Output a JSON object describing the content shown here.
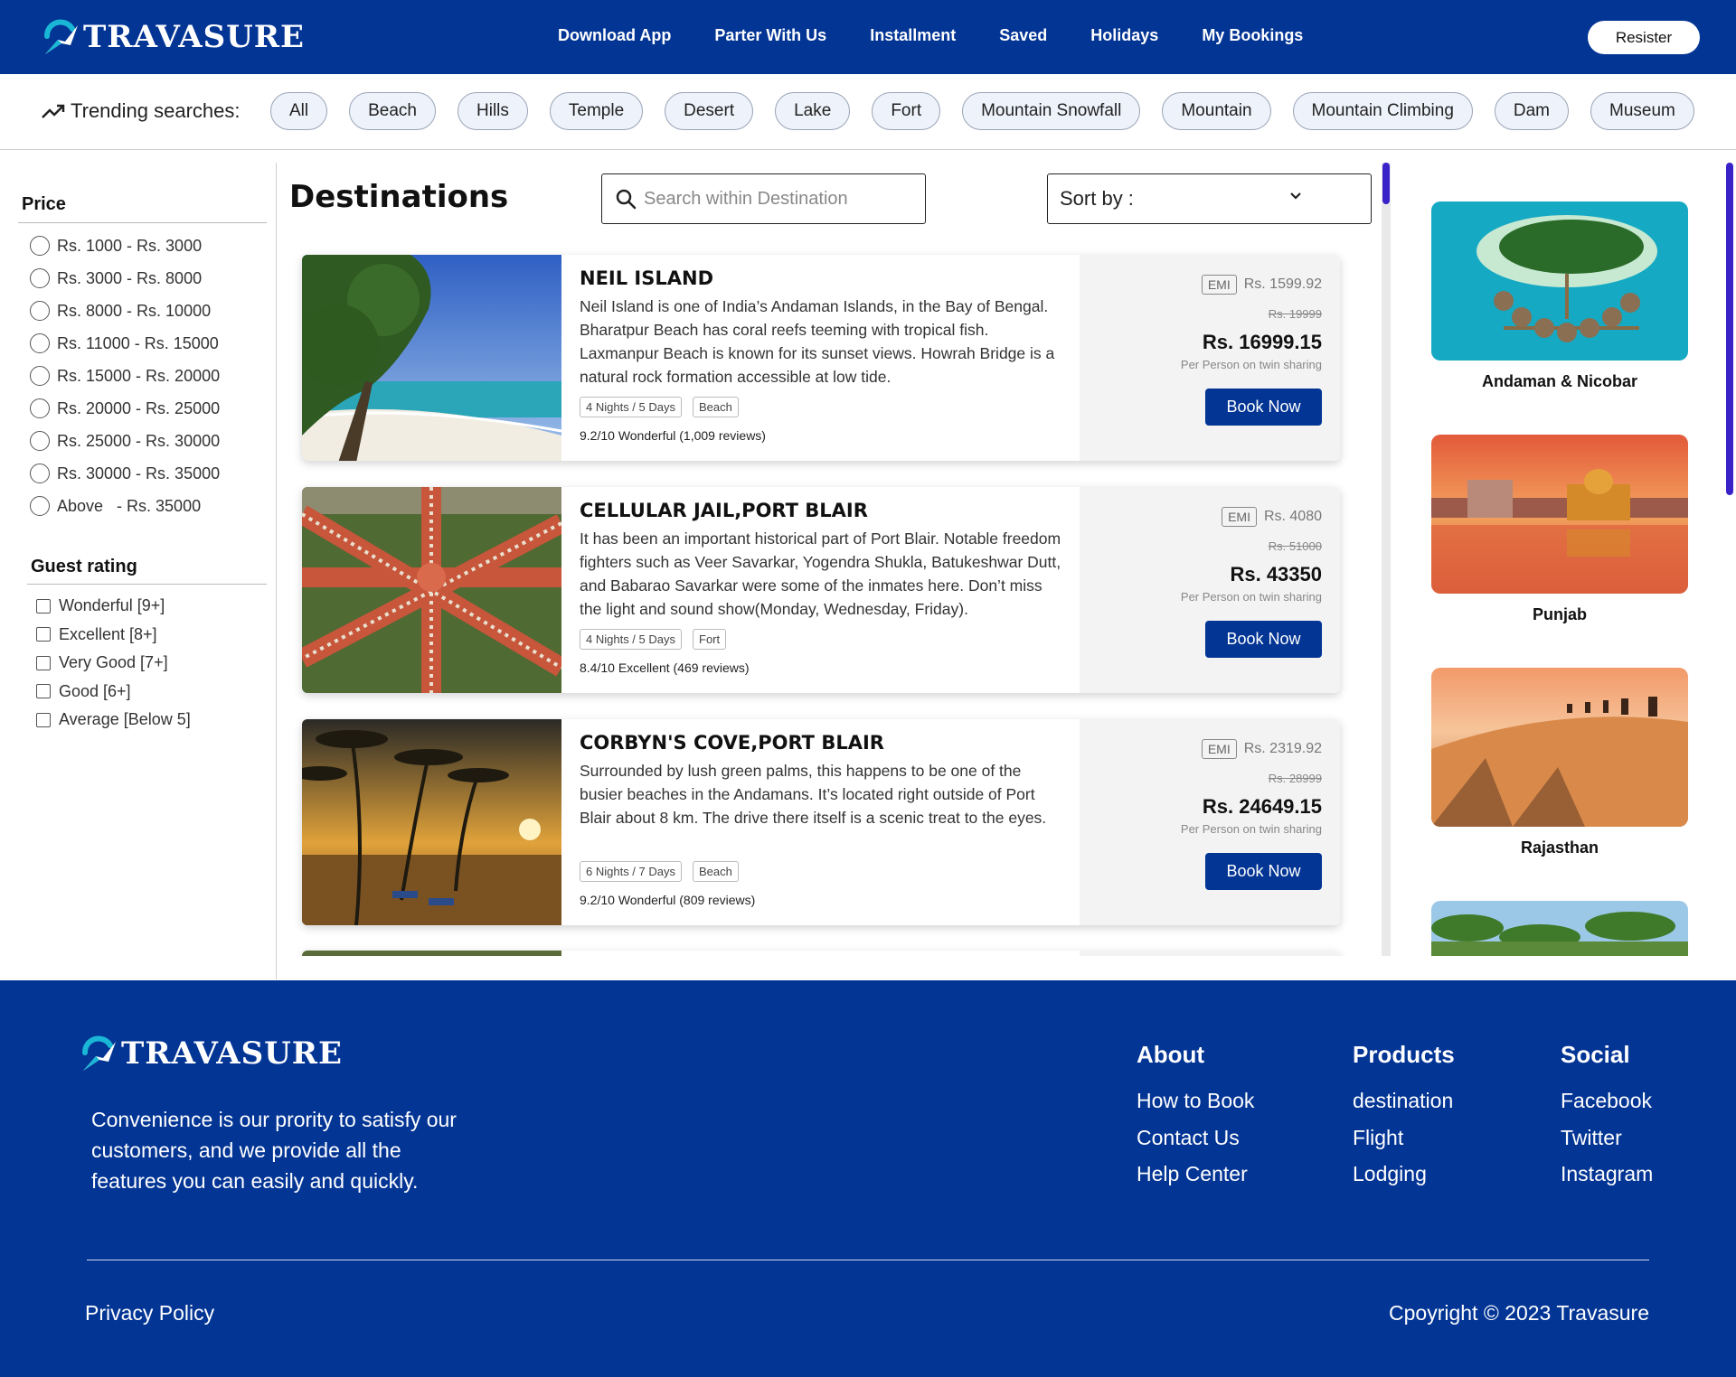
{
  "brand": {
    "name": "TRAVASURE",
    "primary_color": "#033595",
    "accent_color": "#3a22c9"
  },
  "header": {
    "nav": [
      "Download App",
      "Parter With Us",
      "Installment",
      "Saved",
      "Holidays",
      "My Bookings"
    ],
    "register_label": "Resister"
  },
  "trending": {
    "label": "Trending searches:",
    "icon": "trending-up-icon",
    "chips": [
      "All",
      "Beach",
      "Hills",
      "Temple",
      "Desert",
      "Lake",
      "Fort",
      "Mountain Snowfall",
      "Mountain",
      "Mountain Climbing",
      "Dam",
      "Museum"
    ]
  },
  "filters": {
    "price": {
      "title": "Price",
      "options": [
        "Rs. 1000 - Rs. 3000",
        "Rs. 3000 - Rs. 8000",
        "Rs. 8000 - Rs. 10000",
        "Rs. 11000 - Rs. 15000",
        "Rs. 15000 - Rs. 20000",
        "Rs. 20000 - Rs. 25000",
        "Rs. 25000 - Rs. 30000",
        "Rs. 30000 - Rs. 35000",
        "Above   - Rs. 35000"
      ]
    },
    "rating": {
      "title": "Guest rating",
      "options": [
        "Wonderful [9+]",
        "Excellent [8+]",
        "Very Good [7+]",
        "Good [6+]",
        "Average [Below 5]"
      ]
    }
  },
  "main": {
    "title": "Destinations",
    "search_placeholder": "Search within Destination",
    "sort_label": "Sort by :"
  },
  "cards": [
    {
      "title": "NEIL ISLAND",
      "description": "Neil Island is one of India’s Andaman Islands, in the Bay of Bengal. Bharatpur Beach has coral reefs teeming with tropical fish. Laxmanpur Beach is known for its sunset views. Howrah Bridge is a natural rock formation accessible at low tide.",
      "duration": "4 Nights / 5 Days",
      "category": "Beach",
      "rating": "9.2/10 Wonderful (1,009 reviews)",
      "emi_badge": "EMI",
      "emi": "Rs. 1599.92",
      "old_price": "Rs. 19999",
      "price": "Rs. 16999.15",
      "per_person": "Per Person on twin sharing",
      "book_label": "Book Now"
    },
    {
      "title": "CELLULAR JAIL,PORT BLAIR",
      "description": "It has been an important historical part of Port Blair. Notable freedom fighters such as Veer Savarkar, Yogendra Shukla, Batukeshwar Dutt, and Babarao Savarkar were some of the inmates here. Don’t miss the light and sound show(Monday, Wednesday, Friday).",
      "duration": "4 Nights / 5 Days",
      "category": "Fort",
      "rating": "8.4/10 Excellent (469 reviews)",
      "emi_badge": "EMI",
      "emi": "Rs. 4080",
      "old_price": "Rs. 51000",
      "price": "Rs. 43350",
      "per_person": "Per Person on twin sharing",
      "book_label": "Book Now"
    },
    {
      "title": "CORBYN'S COVE,PORT BLAIR",
      "description": "Surrounded by lush green palms, this happens to be one of the busier beaches in the Andamans. It’s located right outside of Port Blair about 8 km. The drive there itself is a scenic treat to the eyes.",
      "duration": "6 Nights / 7 Days",
      "category": "Beach",
      "rating": "9.2/10 Wonderful (809 reviews)",
      "emi_badge": "EMI",
      "emi": "Rs. 2319.92",
      "old_price": "Rs. 28999",
      "price": "Rs. 24649.15",
      "per_person": "Per Person on twin sharing",
      "book_label": "Book Now"
    }
  ],
  "destinations": [
    "Andaman & Nicobar",
    "Punjab",
    "Rajasthan"
  ],
  "footer": {
    "tagline": "Convenience is our prority to satisfy our customers, and we provide all the features you can easily and quickly.",
    "about": {
      "title": "About",
      "links": [
        "How to Book",
        "Contact Us",
        "Help Center"
      ]
    },
    "products": {
      "title": "Products",
      "links": [
        "destination",
        "Flight",
        "Lodging"
      ]
    },
    "social": {
      "title": "Social",
      "links": [
        "Facebook",
        "Twitter",
        "Instagram"
      ]
    },
    "privacy": "Privacy Policy",
    "copyright": "Cpoyright © 2023 Travasure"
  }
}
